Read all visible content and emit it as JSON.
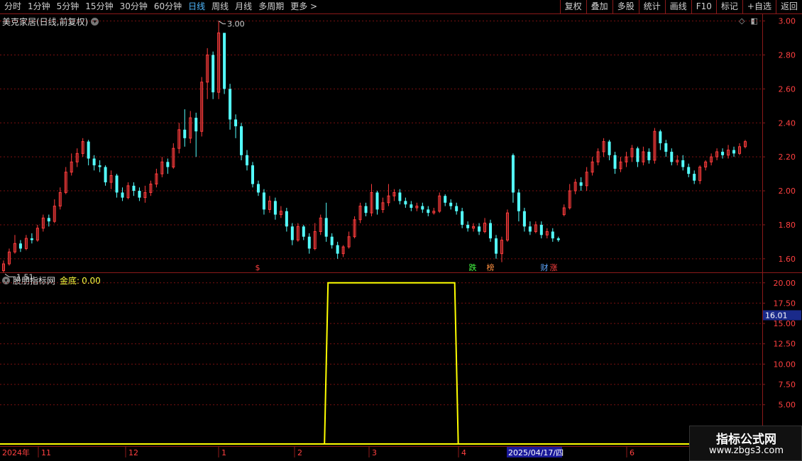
{
  "toolbar": {
    "periods": [
      "分时",
      "1分钟",
      "5分钟",
      "15分钟",
      "30分钟",
      "60分钟",
      "日线",
      "周线",
      "月线",
      "多周期",
      "更多 >"
    ],
    "active_period": "日线",
    "right_buttons": [
      "复权",
      "叠加",
      "多股",
      "统计",
      "画线",
      "F10",
      "标记",
      "+自选",
      "返回"
    ]
  },
  "main_chart": {
    "title": "美克家居(日线,前复权)",
    "high_label": "3.00",
    "low_label": "1.51",
    "y_ticks": [
      "3.00",
      "2.80",
      "2.60",
      "2.40",
      "2.20",
      "2.00",
      "1.80",
      "1.60"
    ],
    "events": [
      {
        "label": "$",
        "color": "#ff4040"
      },
      {
        "label": "跌",
        "color": "#44ff44"
      },
      {
        "label": "榜",
        "color": "#ff9040"
      },
      {
        "label": "财",
        "color": "#5fa8ff"
      },
      {
        "label": "涨",
        "color": "#ff4040"
      }
    ]
  },
  "indicator": {
    "title": "股朋指标网",
    "metric_label": "金底:",
    "metric_value": "0.00",
    "y_ticks": [
      "20.00",
      "17.50",
      "15.00",
      "12.50",
      "10.00",
      "7.50",
      "5.00"
    ],
    "cursor_value": "16.01"
  },
  "date_axis": {
    "labels": [
      "2024年",
      "11",
      "12",
      "1",
      "2",
      "3",
      "4",
      "2025/04/17/四",
      "6"
    ]
  },
  "watermark": {
    "line1": "指标公式网",
    "line2": "www.zbgs3.com"
  },
  "chart_data": {
    "type": "candlestick+line",
    "price_high": 3.0,
    "price_low": 1.51,
    "price_ylim": [
      1.52,
      3.04
    ],
    "indicator_ylim": [
      0,
      21.2
    ],
    "indicator_series": {
      "name": "金底",
      "steps": [
        {
          "from_index": 0,
          "value": 0
        },
        {
          "from_index": 57,
          "value": 20
        },
        {
          "from_index": 80,
          "value": 0
        }
      ]
    },
    "candles": [
      [
        1.53,
        1.57,
        1.52,
        1.59
      ],
      [
        1.57,
        1.64,
        1.56,
        1.66
      ],
      [
        1.64,
        1.69,
        1.63,
        1.74
      ],
      [
        1.69,
        1.66,
        1.64,
        1.71
      ],
      [
        1.66,
        1.72,
        1.65,
        1.74
      ],
      [
        1.72,
        1.71,
        1.69,
        1.75
      ],
      [
        1.71,
        1.78,
        1.7,
        1.8
      ],
      [
        1.78,
        1.84,
        1.76,
        1.86
      ],
      [
        1.84,
        1.82,
        1.79,
        1.86
      ],
      [
        1.82,
        1.91,
        1.81,
        1.95
      ],
      [
        1.91,
        1.99,
        1.89,
        2.02
      ],
      [
        1.99,
        2.11,
        1.98,
        2.14
      ],
      [
        2.11,
        2.17,
        2.09,
        2.22
      ],
      [
        2.17,
        2.22,
        2.14,
        2.25
      ],
      [
        2.22,
        2.29,
        2.2,
        2.31
      ],
      [
        2.29,
        2.19,
        2.15,
        2.3
      ],
      [
        2.19,
        2.15,
        2.12,
        2.21
      ],
      [
        2.15,
        2.14,
        2.11,
        2.18
      ],
      [
        2.14,
        2.05,
        2.03,
        2.15
      ],
      [
        2.05,
        2.09,
        2.01,
        2.12
      ],
      [
        2.09,
        1.99,
        1.96,
        2.1
      ],
      [
        1.99,
        1.96,
        1.94,
        2.02
      ],
      [
        1.96,
        2.03,
        1.95,
        2.05
      ],
      [
        2.03,
        2.0,
        1.97,
        2.05
      ],
      [
        2.0,
        1.96,
        1.94,
        2.02
      ],
      [
        1.96,
        1.99,
        1.93,
        2.03
      ],
      [
        1.99,
        2.04,
        1.97,
        2.06
      ],
      [
        2.04,
        2.1,
        2.02,
        2.13
      ],
      [
        2.1,
        2.17,
        2.08,
        2.2
      ],
      [
        2.17,
        2.14,
        2.1,
        2.19
      ],
      [
        2.14,
        2.25,
        2.13,
        2.28
      ],
      [
        2.25,
        2.36,
        2.22,
        2.4
      ],
      [
        2.36,
        2.31,
        2.26,
        2.48
      ],
      [
        2.31,
        2.43,
        2.28,
        2.47
      ],
      [
        2.43,
        2.35,
        2.2,
        2.46
      ],
      [
        2.35,
        2.64,
        2.32,
        2.67
      ],
      [
        2.64,
        2.8,
        2.54,
        2.84
      ],
      [
        2.8,
        2.58,
        2.54,
        2.82
      ],
      [
        2.58,
        2.93,
        2.54,
        3.0
      ],
      [
        2.93,
        2.6,
        2.57,
        2.92
      ],
      [
        2.6,
        2.42,
        2.36,
        2.63
      ],
      [
        2.42,
        2.38,
        2.31,
        2.45
      ],
      [
        2.38,
        2.21,
        2.18,
        2.4
      ],
      [
        2.21,
        2.15,
        2.12,
        2.24
      ],
      [
        2.15,
        2.04,
        2.02,
        2.17
      ],
      [
        2.04,
        1.99,
        1.97,
        2.06
      ],
      [
        1.99,
        1.89,
        1.86,
        2.01
      ],
      [
        1.89,
        1.94,
        1.87,
        1.97
      ],
      [
        1.94,
        1.86,
        1.83,
        1.96
      ],
      [
        1.86,
        1.88,
        1.84,
        1.91
      ],
      [
        1.88,
        1.79,
        1.76,
        1.9
      ],
      [
        1.79,
        1.71,
        1.68,
        1.81
      ],
      [
        1.71,
        1.79,
        1.7,
        1.81
      ],
      [
        1.79,
        1.73,
        1.71,
        1.8
      ],
      [
        1.73,
        1.66,
        1.63,
        1.75
      ],
      [
        1.66,
        1.76,
        1.65,
        1.81
      ],
      [
        1.76,
        1.84,
        1.74,
        1.86
      ],
      [
        1.84,
        1.73,
        1.7,
        1.93
      ],
      [
        1.73,
        1.68,
        1.66,
        1.75
      ],
      [
        1.68,
        1.63,
        1.6,
        1.7
      ],
      [
        1.63,
        1.67,
        1.61,
        1.68
      ],
      [
        1.67,
        1.73,
        1.66,
        1.76
      ],
      [
        1.73,
        1.83,
        1.72,
        1.85
      ],
      [
        1.83,
        1.91,
        1.81,
        1.93
      ],
      [
        1.91,
        1.87,
        1.85,
        1.93
      ],
      [
        1.87,
        1.99,
        1.85,
        2.04
      ],
      [
        1.99,
        1.89,
        1.86,
        2.0
      ],
      [
        1.89,
        1.93,
        1.87,
        1.96
      ],
      [
        1.93,
        1.97,
        1.91,
        2.04
      ],
      [
        1.97,
        1.99,
        1.94,
        2.01
      ],
      [
        1.99,
        1.94,
        1.92,
        2.01
      ],
      [
        1.94,
        1.92,
        1.9,
        1.96
      ],
      [
        1.92,
        1.9,
        1.88,
        1.94
      ],
      [
        1.9,
        1.91,
        1.88,
        1.93
      ],
      [
        1.91,
        1.89,
        1.87,
        1.93
      ],
      [
        1.89,
        1.87,
        1.85,
        1.91
      ],
      [
        1.87,
        1.88,
        1.86,
        1.9
      ],
      [
        1.88,
        1.97,
        1.87,
        1.99
      ],
      [
        1.97,
        1.93,
        1.91,
        1.98
      ],
      [
        1.93,
        1.91,
        1.89,
        1.95
      ],
      [
        1.91,
        1.88,
        1.86,
        1.93
      ],
      [
        1.88,
        1.8,
        1.78,
        1.9
      ],
      [
        1.8,
        1.78,
        1.76,
        1.82
      ],
      [
        1.78,
        1.79,
        1.76,
        1.81
      ],
      [
        1.79,
        1.76,
        1.74,
        1.81
      ],
      [
        1.76,
        1.81,
        1.75,
        1.84
      ],
      [
        1.81,
        1.72,
        1.7,
        1.83
      ],
      [
        1.72,
        1.63,
        1.6,
        1.74
      ],
      [
        1.63,
        1.71,
        1.58,
        1.73
      ],
      [
        1.71,
        1.87,
        1.7,
        1.89
      ],
      [
        2.21,
        1.99,
        1.93,
        2.22
      ],
      [
        1.99,
        1.88,
        1.82,
        2.01
      ],
      [
        1.88,
        1.79,
        1.76,
        1.9
      ],
      [
        1.79,
        1.76,
        1.74,
        1.82
      ],
      [
        1.76,
        1.8,
        1.75,
        1.82
      ],
      [
        1.8,
        1.74,
        1.72,
        1.82
      ],
      [
        1.74,
        1.76,
        1.72,
        1.78
      ],
      [
        1.76,
        1.72,
        1.7,
        1.78
      ],
      [
        1.72,
        1.71,
        1.7,
        1.73
      ],
      [
        1.86,
        1.9,
        1.85,
        1.92
      ],
      [
        1.9,
        2.0,
        1.89,
        2.04
      ],
      [
        2.0,
        2.05,
        1.98,
        2.07
      ],
      [
        2.05,
        2.03,
        2.0,
        2.08
      ],
      [
        2.03,
        2.11,
        2.0,
        2.14
      ],
      [
        2.11,
        2.17,
        2.09,
        2.2
      ],
      [
        2.17,
        2.23,
        2.15,
        2.25
      ],
      [
        2.23,
        2.29,
        2.2,
        2.31
      ],
      [
        2.29,
        2.21,
        2.18,
        2.3
      ],
      [
        2.21,
        2.13,
        2.1,
        2.23
      ],
      [
        2.13,
        2.17,
        2.11,
        2.2
      ],
      [
        2.17,
        2.2,
        2.14,
        2.23
      ],
      [
        2.2,
        2.25,
        2.17,
        2.27
      ],
      [
        2.25,
        2.17,
        2.14,
        2.26
      ],
      [
        2.17,
        2.23,
        2.15,
        2.26
      ],
      [
        2.23,
        2.18,
        2.16,
        2.25
      ],
      [
        2.18,
        2.35,
        2.16,
        2.37
      ],
      [
        2.35,
        2.28,
        2.24,
        2.36
      ],
      [
        2.28,
        2.23,
        2.2,
        2.3
      ],
      [
        2.23,
        2.17,
        2.15,
        2.25
      ],
      [
        2.17,
        2.18,
        2.15,
        2.21
      ],
      [
        2.18,
        2.14,
        2.12,
        2.21
      ],
      [
        2.14,
        2.1,
        2.08,
        2.16
      ],
      [
        2.1,
        2.06,
        2.04,
        2.12
      ],
      [
        2.06,
        2.14,
        2.04,
        2.15
      ],
      [
        2.14,
        2.17,
        2.12,
        2.18
      ],
      [
        2.17,
        2.2,
        2.15,
        2.22
      ],
      [
        2.2,
        2.23,
        2.18,
        2.25
      ],
      [
        2.23,
        2.21,
        2.19,
        2.25
      ],
      [
        2.21,
        2.24,
        2.19,
        2.27
      ],
      [
        2.24,
        2.22,
        2.2,
        2.26
      ],
      [
        2.22,
        2.26,
        2.21,
        2.28
      ],
      [
        2.26,
        2.29,
        2.25,
        2.3
      ]
    ]
  }
}
